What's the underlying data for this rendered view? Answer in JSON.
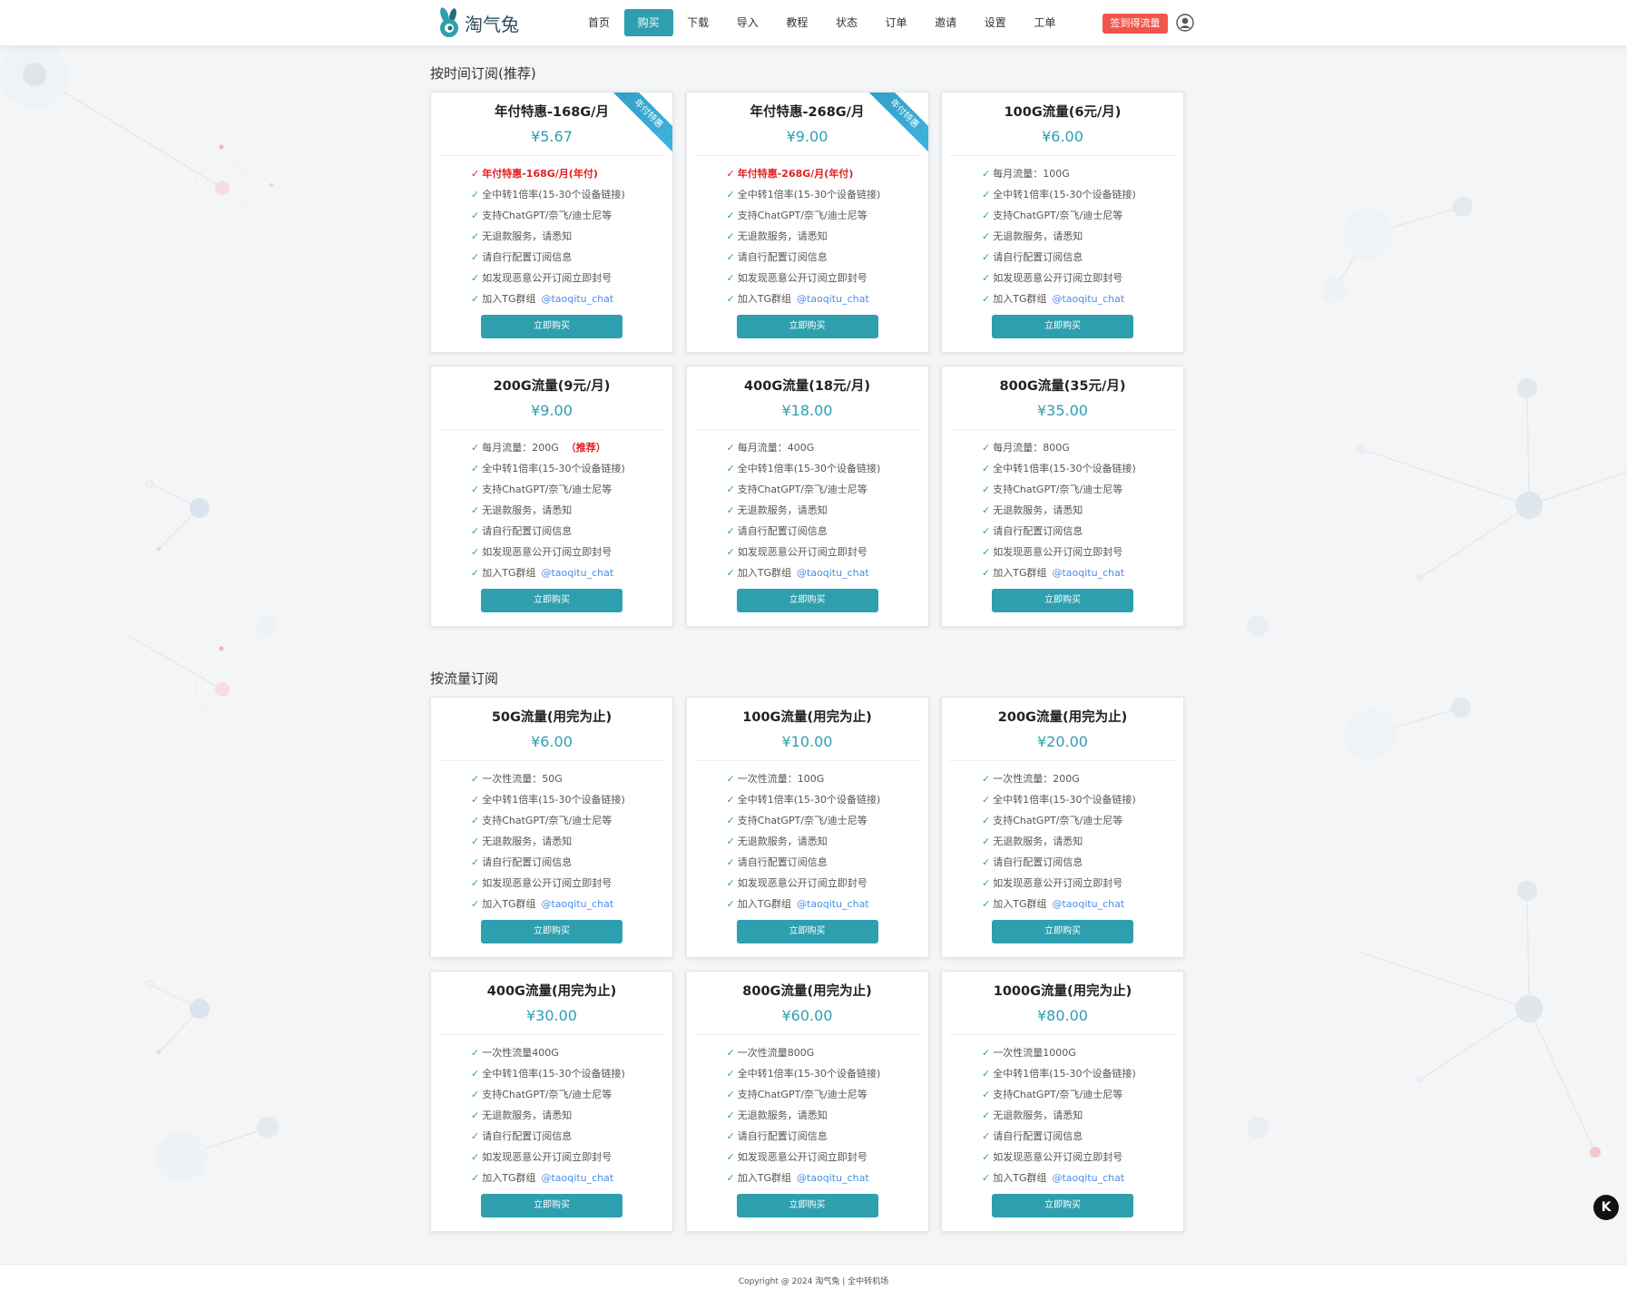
{
  "brand": {
    "name": "淘气兔"
  },
  "nav": {
    "items": [
      {
        "label": "首页"
      },
      {
        "label": "购买"
      },
      {
        "label": "下载"
      },
      {
        "label": "导入"
      },
      {
        "label": "教程"
      },
      {
        "label": "状态"
      },
      {
        "label": "订单"
      },
      {
        "label": "邀请"
      },
      {
        "label": "设置"
      },
      {
        "label": "工单"
      }
    ],
    "active_label": "购买",
    "checkin_label": "签到得流量",
    "avatar_icon": "user-circle-icon"
  },
  "colors": {
    "accent": "#2e9faf",
    "danger": "#f0554b",
    "link": "#4a8fe7",
    "highlight_red": "#e02020"
  },
  "sections": {
    "time": {
      "title": "按时间订阅(推荐)",
      "plans": [
        {
          "title": "年付特惠-168G/月",
          "price": "¥5.67",
          "ribbon": "年付特惠",
          "features": [
            "年付特惠-168G/月(年付)",
            "全中转1倍率(15-30个设备链接)",
            "支持ChatGPT/奈飞/迪士尼等",
            "无退款服务，请悉知",
            "请自行配置订阅信息",
            "如发现恶意公开订阅立即封号",
            "加入TG群组"
          ],
          "tg": "@taoqitu_chat",
          "button": "立即购买"
        },
        {
          "title": "年付特惠-268G/月",
          "price": "¥9.00",
          "ribbon": "年付特惠",
          "features": [
            "年付特惠-268G/月(年付)",
            "全中转1倍率(15-30个设备链接)",
            "支持ChatGPT/奈飞/迪士尼等",
            "无退款服务，请悉知",
            "请自行配置订阅信息",
            "如发现恶意公开订阅立即封号",
            "加入TG群组"
          ],
          "tg": "@taoqitu_chat",
          "button": "立即购买"
        },
        {
          "title": "100G流量(6元/月)",
          "price": "¥6.00",
          "features": [
            "每月流量：100G",
            "全中转1倍率(15-30个设备链接)",
            "支持ChatGPT/奈飞/迪士尼等",
            "无退款服务，请悉知",
            "请自行配置订阅信息",
            "如发现恶意公开订阅立即封号",
            "加入TG群组"
          ],
          "tg": "@taoqitu_chat",
          "button": "立即购买"
        },
        {
          "title": "200G流量(9元/月)",
          "price": "¥9.00",
          "features": [
            "每月流量：200G",
            "全中转1倍率(15-30个设备链接)",
            "支持ChatGPT/奈飞/迪士尼等",
            "无退款服务，请悉知",
            "请自行配置订阅信息",
            "如发现恶意公开订阅立即封号",
            "加入TG群组"
          ],
          "recommend_tag": "（推荐）",
          "tg": "@taoqitu_chat",
          "button": "立即购买"
        },
        {
          "title": "400G流量(18元/月)",
          "price": "¥18.00",
          "features": [
            "每月流量：400G",
            "全中转1倍率(15-30个设备链接)",
            "支持ChatGPT/奈飞/迪士尼等",
            "无退款服务，请悉知",
            "请自行配置订阅信息",
            "如发现恶意公开订阅立即封号",
            "加入TG群组"
          ],
          "tg": "@taoqitu_chat",
          "button": "立即购买"
        },
        {
          "title": "800G流量(35元/月)",
          "price": "¥35.00",
          "features": [
            "每月流量：800G",
            "全中转1倍率(15-30个设备链接)",
            "支持ChatGPT/奈飞/迪士尼等",
            "无退款服务，请悉知",
            "请自行配置订阅信息",
            "如发现恶意公开订阅立即封号",
            "加入TG群组"
          ],
          "tg": "@taoqitu_chat",
          "button": "立即购买"
        }
      ]
    },
    "traffic": {
      "title": "按流量订阅",
      "plans": [
        {
          "title": "50G流量(用完为止)",
          "price": "¥6.00",
          "features": [
            "一次性流量：50G",
            "全中转1倍率(15-30个设备链接)",
            "支持ChatGPT/奈飞/迪士尼等",
            "无退款服务，请悉知",
            "请自行配置订阅信息",
            "如发现恶意公开订阅立即封号",
            "加入TG群组"
          ],
          "tg": "@taoqitu_chat",
          "button": "立即购买"
        },
        {
          "title": "100G流量(用完为止)",
          "price": "¥10.00",
          "features": [
            "一次性流量：100G",
            "全中转1倍率(15-30个设备链接)",
            "支持ChatGPT/奈飞/迪士尼等",
            "无退款服务，请悉知",
            "请自行配置订阅信息",
            "如发现恶意公开订阅立即封号",
            "加入TG群组"
          ],
          "tg": "@taoqitu_chat",
          "button": "立即购买"
        },
        {
          "title": "200G流量(用完为止)",
          "price": "¥20.00",
          "features": [
            "一次性流量：200G",
            "全中转1倍率(15-30个设备链接)",
            "支持ChatGPT/奈飞/迪士尼等",
            "无退款服务，请悉知",
            "请自行配置订阅信息",
            "如发现恶意公开订阅立即封号",
            "加入TG群组"
          ],
          "tg": "@taoqitu_chat",
          "button": "立即购买"
        },
        {
          "title": "400G流量(用完为止)",
          "price": "¥30.00",
          "features": [
            "一次性流量400G",
            "全中转1倍率(15-30个设备链接)",
            "支持ChatGPT/奈飞/迪士尼等",
            "无退款服务，请悉知",
            "请自行配置订阅信息",
            "如发现恶意公开订阅立即封号",
            "加入TG群组"
          ],
          "tg": "@taoqitu_chat",
          "button": "立即购买"
        },
        {
          "title": "800G流量(用完为止)",
          "price": "¥60.00",
          "features": [
            "一次性流量800G",
            "全中转1倍率(15-30个设备链接)",
            "支持ChatGPT/奈飞/迪士尼等",
            "无退款服务，请悉知",
            "请自行配置订阅信息",
            "如发现恶意公开订阅立即封号",
            "加入TG群组"
          ],
          "tg": "@taoqitu_chat",
          "button": "立即购买"
        },
        {
          "title": "1000G流量(用完为止)",
          "price": "¥80.00",
          "features": [
            "一次性流量1000G",
            "全中转1倍率(15-30个设备链接)",
            "支持ChatGPT/奈飞/迪士尼等",
            "无退款服务，请悉知",
            "请自行配置订阅信息",
            "如发现恶意公开订阅立即封号",
            "加入TG群组"
          ],
          "tg": "@taoqitu_chat",
          "button": "立即购买"
        }
      ]
    }
  },
  "footer": {
    "copyright": "Copyright @ 2024 淘气兔 | 全中转机场"
  },
  "floating_widget": {
    "label": "K",
    "icon": "k-badge-icon"
  }
}
